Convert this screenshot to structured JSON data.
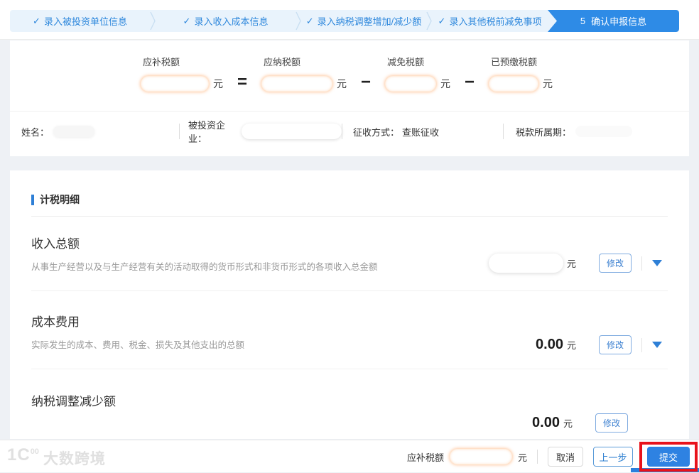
{
  "colors": {
    "accent_blue": "#2E8BE6",
    "step_text_blue": "#2D87DC",
    "step_bar_bg": "#E9F3FC",
    "highlight_red": "#E8121A",
    "redaction_glow": "#FFA05A",
    "desc_gray": "#999999"
  },
  "icons": {
    "check": "✓",
    "arrow_down": "triangle-down"
  },
  "steps": [
    {
      "label": "录入被投资单位信息"
    },
    {
      "label": "录入收入成本信息"
    },
    {
      "label": "录入纳税调整增加/减少额"
    },
    {
      "label": "录入其他税前减免事项"
    },
    {
      "number": "5",
      "label": "确认申报信息"
    }
  ],
  "formula": {
    "op_equals": "=",
    "op_minus": "−",
    "unit": "元",
    "terms": [
      {
        "label": "应补税额"
      },
      {
        "label": "应纳税额"
      },
      {
        "label": "减免税额"
      },
      {
        "label": "已预缴税额"
      }
    ]
  },
  "info_bar": {
    "name_label": "姓名：",
    "invested_label": "被投资企业：",
    "method_label": "征收方式：",
    "method_value": "查账征收",
    "period_label": "税款所属期："
  },
  "detail_section": {
    "title": "计税明细",
    "rows": [
      {
        "title": "收入总额",
        "desc": "从事生产经营以及与生产经营有关的活动取得的货币形式和非货币形式的各项收入总金额",
        "value": "",
        "unit": "元",
        "edit_label": "修改"
      },
      {
        "title": "成本费用",
        "desc": "实际发生的成本、费用、税金、损失及其他支出的总额",
        "value": "0.00",
        "unit": "元",
        "edit_label": "修改"
      },
      {
        "title": "纳税调整减少额",
        "desc": "",
        "value": "0.00",
        "unit": "元",
        "edit_label": "修改"
      }
    ]
  },
  "footer": {
    "amount_label": "应补税额",
    "unit": "元",
    "cancel_label": "取消",
    "prev_label": "上一步",
    "submit_label": "提交",
    "watermark_mark": "1C",
    "watermark_mark_sup": "00",
    "watermark_text": "大数跨境"
  }
}
